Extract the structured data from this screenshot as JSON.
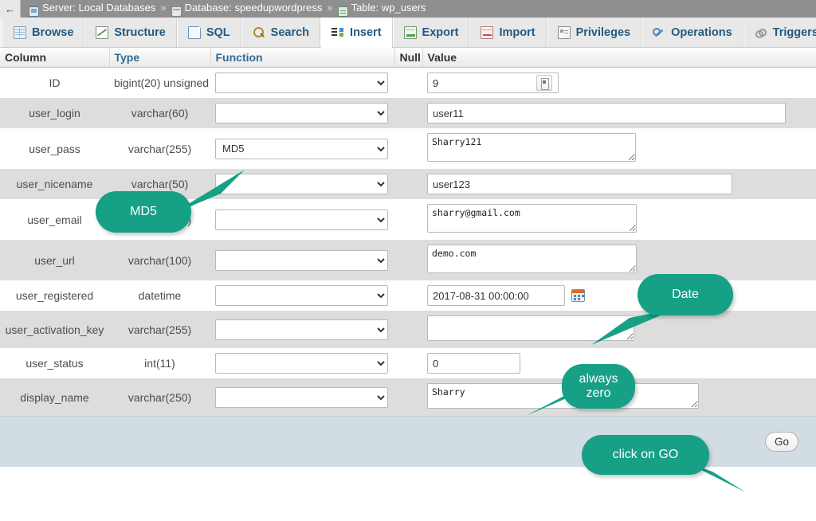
{
  "breadcrumb": {
    "back_arrow": "←",
    "items": [
      {
        "icon": "server-icon",
        "label": "Server: Local Databases"
      },
      {
        "icon": "database-icon",
        "label": "Database: speedupwordpress"
      },
      {
        "icon": "table-icon",
        "label": "Table: wp_users"
      }
    ],
    "separator": "»"
  },
  "tabs": [
    {
      "label": "Browse",
      "icon": "browse-icon",
      "active": false
    },
    {
      "label": "Structure",
      "icon": "structure-icon",
      "active": false
    },
    {
      "label": "SQL",
      "icon": "sql-icon",
      "active": false
    },
    {
      "label": "Search",
      "icon": "search-icon",
      "active": false
    },
    {
      "label": "Insert",
      "icon": "insert-icon",
      "active": true
    },
    {
      "label": "Export",
      "icon": "export-icon",
      "active": false
    },
    {
      "label": "Import",
      "icon": "import-icon",
      "active": false
    },
    {
      "label": "Privileges",
      "icon": "privileges-icon",
      "active": false
    },
    {
      "label": "Operations",
      "icon": "operations-icon",
      "active": false
    },
    {
      "label": "Triggers",
      "icon": "triggers-icon",
      "active": false
    }
  ],
  "table": {
    "headers": {
      "column": "Column",
      "type": "Type",
      "function": "Function",
      "null": "Null",
      "value": "Value"
    },
    "rows": [
      {
        "column": "ID",
        "type": "bigint(20) unsigned",
        "function": "",
        "null": "",
        "value": "9"
      },
      {
        "column": "user_login",
        "type": "varchar(60)",
        "function": "",
        "null": "",
        "value": "user11"
      },
      {
        "column": "user_pass",
        "type": "varchar(255)",
        "function": "MD5",
        "null": "",
        "value": "Sharry121"
      },
      {
        "column": "user_nicename",
        "type": "varchar(50)",
        "function": "",
        "null": "",
        "value": "user123"
      },
      {
        "column": "user_email",
        "type": "varchar(100)",
        "function": "",
        "null": "",
        "value": "sharry@gmail.com"
      },
      {
        "column": "user_url",
        "type": "varchar(100)",
        "function": "",
        "null": "",
        "value": "demo.com"
      },
      {
        "column": "user_registered",
        "type": "datetime",
        "function": "",
        "null": "",
        "value": "2017-08-31 00:00:00"
      },
      {
        "column": "user_activation_key",
        "type": "varchar(255)",
        "function": "",
        "null": "",
        "value": ""
      },
      {
        "column": "user_status",
        "type": "int(11)",
        "function": "",
        "null": "",
        "value": "0"
      },
      {
        "column": "display_name",
        "type": "varchar(250)",
        "function": "",
        "null": "",
        "value": "Sharry"
      }
    ]
  },
  "footer": {
    "go_label": "Go"
  },
  "callouts": [
    {
      "id": "md5",
      "text": "MD5"
    },
    {
      "id": "date",
      "text": "Date"
    },
    {
      "id": "zero",
      "text": "always\nzero"
    },
    {
      "id": "go",
      "text": "click on GO"
    }
  ],
  "colors": {
    "callout_green": "#16a085",
    "tab_text": "#235a81",
    "row_even": "#dddddd",
    "footer": "#d2dce3"
  }
}
